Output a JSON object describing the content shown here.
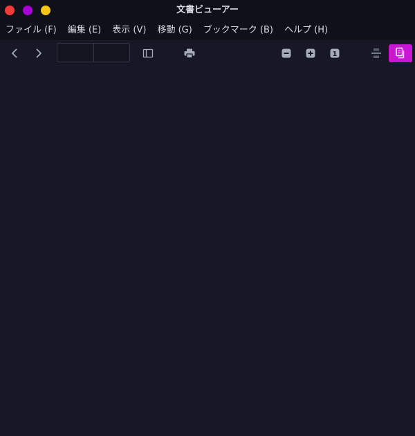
{
  "window": {
    "title": "文書ビューアー",
    "controls": {
      "close_color": "#f13b3b",
      "minimize_color": "#a800d6",
      "maximize_color": "#f5c518"
    }
  },
  "menubar": {
    "items": [
      {
        "label": "ファイル (F)"
      },
      {
        "label": "編集 (E)"
      },
      {
        "label": "表示 (V)"
      },
      {
        "label": "移動 (G)"
      },
      {
        "label": "ブックマーク (B)"
      },
      {
        "label": "ヘルプ (H)"
      }
    ]
  },
  "toolbar": {
    "icons": {
      "back": "chevron-left-icon",
      "forward": "chevron-right-icon",
      "sidebar": "sidebar-icon",
      "print": "printer-icon",
      "zoom_out": "zoom-out-icon",
      "zoom_in": "zoom-in-icon",
      "zoom_reset": "zoom-reset-icon",
      "continuous": "continuous-scroll-icon",
      "dual_page": "dual-page-icon"
    },
    "zoom_reset_label": "1",
    "page_number_value": "",
    "page_count_value": ""
  },
  "colors": {
    "background": "#161826",
    "chrome": "#0f1119",
    "text": "#d8dae3",
    "icon": "#a7aab7",
    "accent": "#c817d4"
  }
}
